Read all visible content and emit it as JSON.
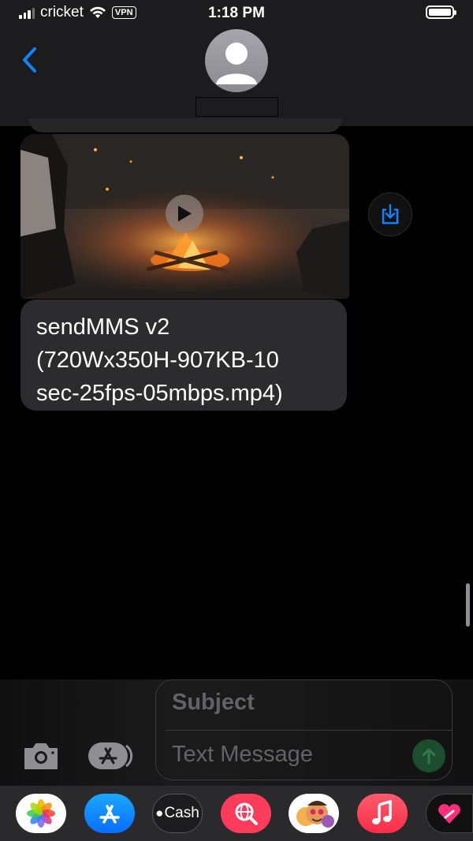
{
  "status_bar": {
    "carrier": "cricket",
    "vpn_label": "VPN",
    "time": "1:18 PM",
    "wifi_icon": "wifi-icon",
    "battery_icon": "battery-icon"
  },
  "header": {
    "back_icon": "chevron-left-icon",
    "avatar_icon": "person-avatar-icon"
  },
  "conversation": {
    "video_message": {
      "play_icon": "play-icon",
      "save_icon": "save-download-icon"
    },
    "text_message": {
      "line1": "sendMMS v2",
      "line2": "(720Wx350H-907KB-10",
      "line3": "sec-25fps-05mbps.mp4)"
    }
  },
  "composer": {
    "subject_placeholder": "Subject",
    "message_placeholder": "Text Message",
    "camera_icon": "camera-icon",
    "apps_icon": "app-store-icon",
    "send_icon": "arrow-up-icon"
  },
  "app_drawer": {
    "apps": [
      {
        "name": "photos",
        "icon": "photos-icon"
      },
      {
        "name": "app-store",
        "icon": "app-store-icon"
      },
      {
        "name": "apple-cash",
        "label": "Cash",
        "icon": "apple-cash-icon"
      },
      {
        "name": "images-search",
        "icon": "globe-search-icon"
      },
      {
        "name": "memoji",
        "icon": "memoji-icon"
      },
      {
        "name": "music",
        "icon": "music-note-icon"
      },
      {
        "name": "digital-touch",
        "icon": "heart-hand-icon"
      }
    ]
  },
  "colors": {
    "accent": "#0a84ff",
    "bubble": "#2c2c2e",
    "header_bg": "#1c1c1e",
    "send_disabled": "#1b4d2e"
  }
}
